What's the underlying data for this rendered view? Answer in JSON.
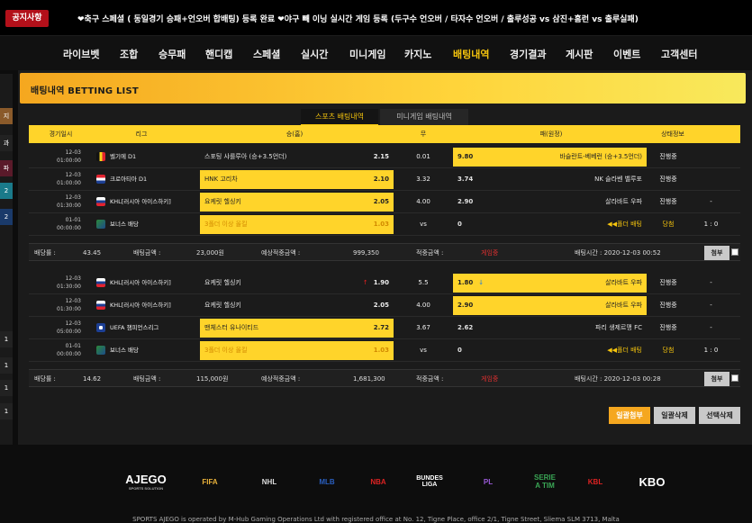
{
  "notice": {
    "badge": "공지사항",
    "text": "❤축구 스페셜 ( 동일경기 승패+언오버 합배팅) 등록 완료 ❤야구 빼 이닝 실시간 게임 등록 (두구수 언오버 / 타자수 언오버 / 출루성공 vs 삼진+홈런 vs 출루실패)"
  },
  "nav": [
    "라이브벳",
    "조합",
    "승무패",
    "핸디캡",
    "스페셜",
    "실시간",
    "미니게임",
    "카지노",
    "배팅내역",
    "경기결과",
    "게시판",
    "이벤트",
    "고객센터"
  ],
  "nav_active": "배팅내역",
  "left_strip": [
    "지",
    "과",
    "파",
    "2",
    "2",
    "1",
    "1",
    "1",
    "1"
  ],
  "page_title": "배팅내역 BETTING LIST",
  "tabs": {
    "sports": "스포츠 배팅내역",
    "mini": "미니게임 배팅내역"
  },
  "columns": {
    "date": "경기일시",
    "league": "리그",
    "home": "승(홈)",
    "draw": "무",
    "away": "패(원정)",
    "status": "상태정보"
  },
  "slips": [
    {
      "rows": [
        {
          "date1": "12-03",
          "date2": "01:00:00",
          "flag": "be",
          "league": "벨기에 D1",
          "home": "스포팅 샤를루아 (승+3.5언더)",
          "home_odds": "2.15",
          "draw": "0.01",
          "away": "바슬란트-베베런 (승+3.5언더)",
          "away_odds": "9.80",
          "selected": "away",
          "status": "진행중",
          "result": ""
        },
        {
          "date1": "12-03",
          "date2": "01:00:00",
          "flag": "hr",
          "league": "크로아티아 D1",
          "home": "HNK 고리차",
          "home_odds": "2.10",
          "draw": "3.32",
          "away": "NK 슬라벤 벨루포",
          "away_odds": "3.74",
          "selected": "home",
          "status": "진행중",
          "result": ""
        },
        {
          "date1": "12-03",
          "date2": "01:30:00",
          "flag": "ru",
          "league": "KHL[러시아 아이스하키]",
          "home": "요케릿 헬싱키",
          "home_odds": "2.05",
          "draw": "4.00",
          "away": "살라바트 우파",
          "away_odds": "2.90",
          "selected": "home",
          "status": "진행중",
          "result": "-"
        },
        {
          "date1": "01-01",
          "date2": "00:00:00",
          "flag": "bonus",
          "league": "보너스 배당",
          "home": "3폴더 이상 올킬",
          "home_odds": "1.03",
          "draw": "vs",
          "away": "◀◀폴더 배팅",
          "away_odds": "0",
          "selected": "bonus",
          "status": "당첨",
          "result": "1 : 0"
        }
      ],
      "summary": {
        "odds_label": "배당률 :",
        "odds": "43.45",
        "bet_label": "배팅금액 :",
        "bet": "23,000원",
        "expected_label": "예상적중금액 :",
        "expected": "999,350",
        "win_label": "적중금액 :",
        "win": "게임중",
        "time": "배팅시간 : 2020-12-03 00:52",
        "attach": "첨부"
      }
    },
    {
      "rows": [
        {
          "date1": "12-03",
          "date2": "01:30:00",
          "flag": "ru",
          "league": "KHL[러시아 아이스하키]",
          "home": "요케릿 헬싱키",
          "home_odds": "1.90",
          "home_icon": "↑",
          "draw": "5.5",
          "away": "살라바트 우파",
          "away_odds": "1.80",
          "away_icon": "↓",
          "selected": "away",
          "status": "진행중",
          "result": "-"
        },
        {
          "date1": "12-03",
          "date2": "01:30:00",
          "flag": "ru",
          "league": "KHL[러시아 아이스하키]",
          "home": "요케릿 헬싱키",
          "home_odds": "2.05",
          "draw": "4.00",
          "away": "살라바트 우파",
          "away_odds": "2.90",
          "selected": "away",
          "status": "진행중",
          "result": "-"
        },
        {
          "date1": "12-03",
          "date2": "05:00:00",
          "flag": "uefa",
          "league": "UEFA 챔피언스리그",
          "home": "맨체스터 유나이티드",
          "home_odds": "2.72",
          "draw": "3.67",
          "away": "파리 생제르맹 FC",
          "away_odds": "2.62",
          "selected": "home",
          "status": "진행중",
          "result": "-"
        },
        {
          "date1": "01-01",
          "date2": "00:00:00",
          "flag": "bonus",
          "league": "보너스 배당",
          "home": "3폴더 이상 올킬",
          "home_odds": "1.03",
          "draw": "vs",
          "away": "◀◀폴더 배팅",
          "away_odds": "0",
          "selected": "bonus",
          "status": "당첨",
          "result": "1 : 0"
        }
      ],
      "summary": {
        "odds_label": "배당률 :",
        "odds": "14.62",
        "bet_label": "배팅금액 :",
        "bet": "115,000원",
        "expected_label": "예상적중금액 :",
        "expected": "1,681,300",
        "win_label": "적중금액 :",
        "win": "게임중",
        "time": "배팅시간 : 2020-12-03 00:28",
        "attach": "첨부"
      }
    }
  ],
  "buttons": {
    "bulk_attach": "일괄첨부",
    "bulk_delete": "일괄삭제",
    "selected_delete": "선택삭제"
  },
  "sponsors": [
    {
      "text": "AJEGO",
      "sub": "SPORTS SOLUTION"
    },
    {
      "text": "FIFA"
    },
    {
      "text": "NHL"
    },
    {
      "text": "MLB"
    },
    {
      "text": "NBA"
    },
    {
      "text": "BUNDES LIGA"
    },
    {
      "text": "PL"
    },
    {
      "text": "SERIE A TIM"
    },
    {
      "text": "KBL"
    },
    {
      "text": "KBO"
    }
  ],
  "footer": "SPORTS AJEGO is operated by M-Hub Gaming Operations Ltd with registered office at No. 12, Tigne Place, office 2/1, Tigne Street, Sliema SLM 3713, Malta",
  "colors": {
    "accent": "#ffd42a",
    "orange": "#f5a71f",
    "red": "#e03030"
  }
}
